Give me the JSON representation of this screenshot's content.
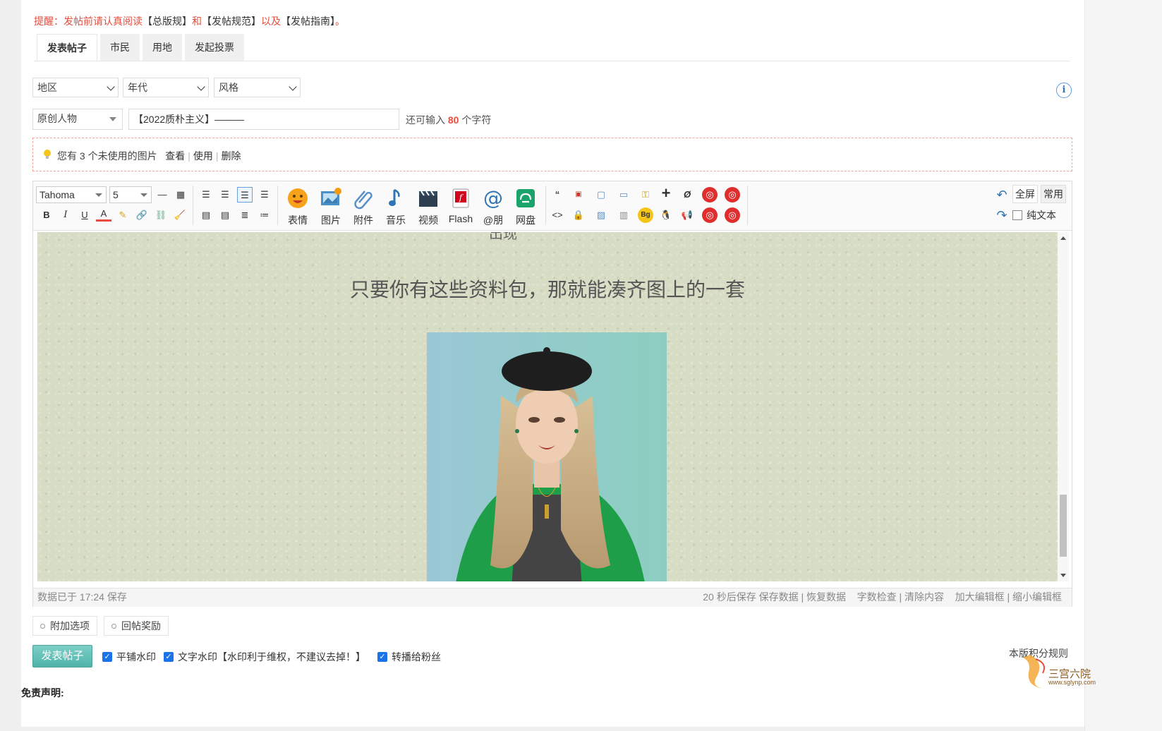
{
  "notice": {
    "prefix": "提醒：发帖前请认真阅读",
    "link1": "【总版规】",
    "and": "和",
    "link2": "【发帖规范】",
    "also": "以及",
    "link3": "【发帖指南】",
    "end": "。"
  },
  "tabs": [
    "发表帖子",
    "市民",
    "用地",
    "发起投票"
  ],
  "filters": {
    "region": "地区",
    "era": "年代",
    "style": "风格"
  },
  "category": {
    "selected": "原创人物"
  },
  "title": {
    "value": "【2022质朴主义】———"
  },
  "counter": {
    "prefix": "还可输入",
    "num": "80",
    "suffix": "个字符"
  },
  "image_notice": {
    "text": "您有 3 个未使用的图片",
    "view": "查看",
    "use": "使用",
    "delete": "删除"
  },
  "toolbar": {
    "font": "Tahoma",
    "size": "5",
    "big_buttons": [
      "表情",
      "图片",
      "附件",
      "音乐",
      "视频",
      "Flash",
      "@朋",
      "网盘"
    ],
    "fullscreen": "全屏",
    "common": "常用",
    "plain_text": "纯文本"
  },
  "content": {
    "cut_text": "出现",
    "main_line": "只要你有这些资料包，那就能凑齐图上的一套"
  },
  "statusbar": {
    "saved": "数据已于 17:24 保存",
    "autosave": "20 秒后保存",
    "save": "保存数据",
    "restore": "恢复数据",
    "wordcheck": "字数检查",
    "clear": "清除内容",
    "enlarge": "加大编辑框",
    "shrink": "缩小编辑框"
  },
  "options": {
    "extra": "附加选项",
    "reward": "回帖奖励"
  },
  "submit": "发表帖子",
  "checks": {
    "tile_wm": "平铺水印",
    "text_wm": "文字水印【水印利于维权，不建议去掉！】",
    "forward": "转播给粉丝"
  },
  "rules": "本版积分规则",
  "disclaimer": "免责声明:",
  "watermark": {
    "name": "三宫六院",
    "url": "www.sglynp.com"
  },
  "colors": {
    "accent": "#e74c3c",
    "submit": "#5ab9b0",
    "check": "#1a73e8"
  }
}
